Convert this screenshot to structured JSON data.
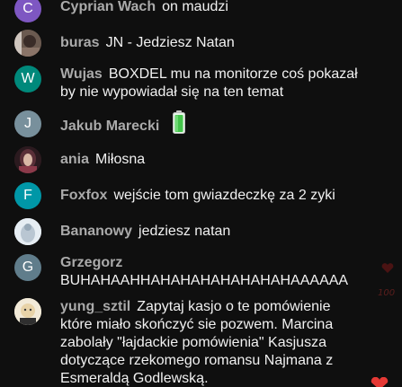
{
  "messages": [
    {
      "author": "Cyprian Wach",
      "text": "on maudzi",
      "avatar_letter": "C",
      "avatar_color": "#7e57c2",
      "avatar_kind": "letter"
    },
    {
      "author": "buras",
      "text": "JN - Jedziesz Natan",
      "avatar_letter": "",
      "avatar_color": "#5b4a42",
      "avatar_kind": "photo"
    },
    {
      "author": "Wujas",
      "text": "BOXDEL mu na monitorze coś pokazał by nie wypowiadał się na ten temat",
      "avatar_letter": "W",
      "avatar_color": "#00897b",
      "avatar_kind": "letter"
    },
    {
      "author": "Jakub Marecki",
      "text": "",
      "avatar_letter": "J",
      "avatar_color": "#78909c",
      "avatar_kind": "letter",
      "emoji": "battery-icon"
    },
    {
      "author": "ania",
      "text": "Miłosna",
      "avatar_letter": "",
      "avatar_color": "#3b1f26",
      "avatar_kind": "photo"
    },
    {
      "author": "Foxfox",
      "text": "wejście tom gwiazdeczkę za 2 zyki",
      "avatar_letter": "F",
      "avatar_color": "#0097a7",
      "avatar_kind": "letter"
    },
    {
      "author": "Bananowy",
      "text": "jedziesz natan",
      "avatar_letter": "",
      "avatar_color": "#dde6ee",
      "avatar_kind": "photo"
    },
    {
      "author": "Grzegorz",
      "text": "BUHAHAAHHAHAHAHAHAHAHAHAAAAAA",
      "avatar_letter": "G",
      "avatar_color": "#607d8b",
      "avatar_kind": "letter"
    },
    {
      "author": "yung_sztil",
      "text": "Zapytaj kasjo o te pomówienie które miało skończyć sie pozwem. Marcina zabolały \"łajdackie pomówienia\" Kasjusza dotyczące rzekomego romansu Najmana z Esmeraldą Godlewską.",
      "avatar_letter": "",
      "avatar_color": "#efe6d2",
      "avatar_kind": "photo"
    }
  ],
  "colors": {
    "background": "#0f0f0f",
    "author": "#aaaaaa",
    "message": "#f1f1f1"
  }
}
